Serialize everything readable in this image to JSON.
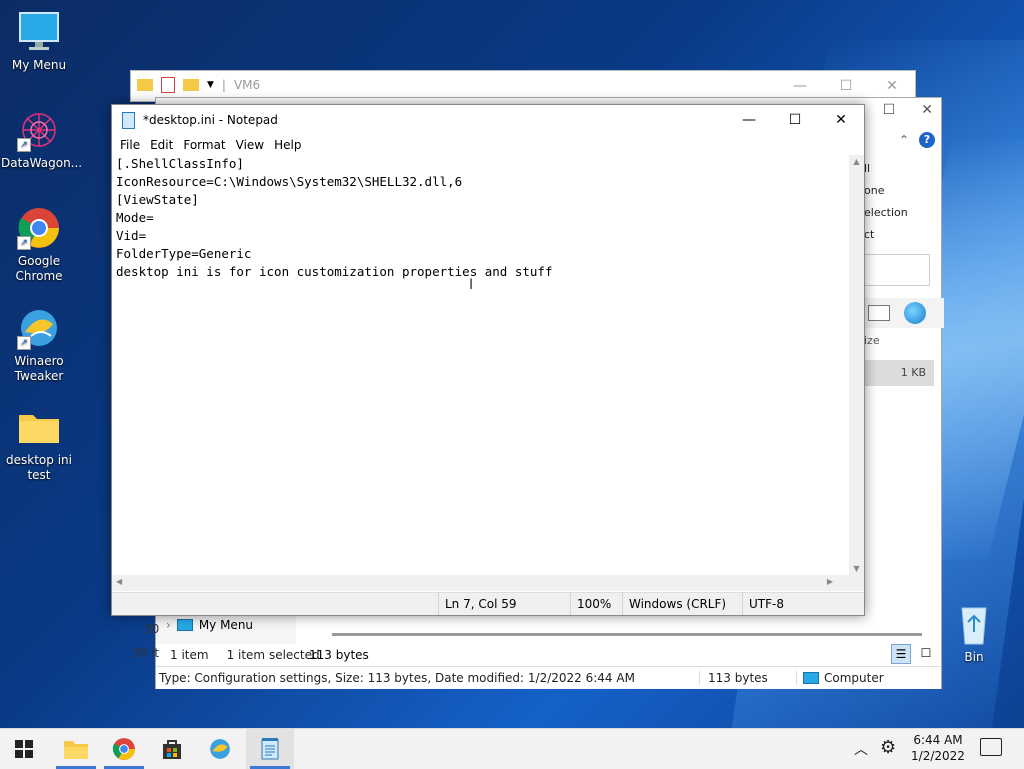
{
  "desktop": {
    "icons": [
      {
        "label": "My Menu"
      },
      {
        "label": "DataWagon..."
      },
      {
        "label": "Google Chrome"
      },
      {
        "label": "Winaero Tweaker"
      },
      {
        "label": "desktop ini test"
      },
      {
        "label": "Bin"
      }
    ]
  },
  "explorer_back": {
    "title": "VM6",
    "right_menu": [
      "ll",
      "one",
      "election",
      "ct"
    ],
    "size_header": "ize",
    "size_value": "1 KB",
    "nav_item": "My Menu",
    "status_count": "1 item",
    "status_selected": "1 item selected",
    "status_size": "113 bytes",
    "left_count_a": "30",
    "left_count_b": "30 it",
    "info_bar": "Type: Configuration settings, Size: 113 bytes, Date modified: 1/2/2022 6:44 AM",
    "info_size": "113 bytes",
    "info_location": "Computer"
  },
  "notepad": {
    "title": "*desktop.ini - Notepad",
    "menu": [
      "File",
      "Edit",
      "Format",
      "View",
      "Help"
    ],
    "content": "[.ShellClassInfo]\nIconResource=C:\\Windows\\System32\\SHELL32.dll,6\n[ViewState]\nMode=\nVid=\nFolderType=Generic\ndesktop ini is for icon customization properties and stuff",
    "status": {
      "position": "Ln 7, Col 59",
      "zoom": "100%",
      "line_ending": "Windows (CRLF)",
      "encoding": "UTF-8"
    }
  },
  "taskbar": {
    "time": "6:44 AM",
    "date": "1/2/2022",
    "apps": [
      "file-explorer",
      "chrome",
      "store",
      "winaero",
      "notepad"
    ]
  },
  "colors": {
    "accent": "#3b78d8",
    "help_blue": "#1c64c8"
  }
}
